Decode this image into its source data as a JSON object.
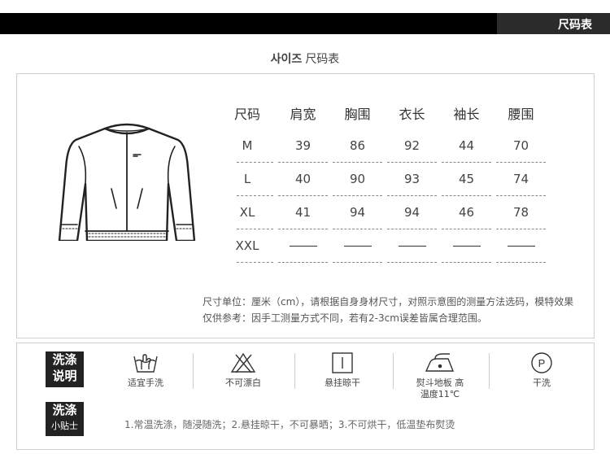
{
  "header": {
    "tab_label": "尺码表"
  },
  "subtitle": {
    "korean": "사이즈",
    "chinese": "尺码表"
  },
  "size_table": {
    "columns": [
      "尺码",
      "肩宽",
      "胸围",
      "衣长",
      "袖长",
      "腰围"
    ],
    "rows": [
      [
        "M",
        "39",
        "86",
        "92",
        "44",
        "70"
      ],
      [
        "L",
        "40",
        "90",
        "93",
        "45",
        "74"
      ],
      [
        "XL",
        "41",
        "94",
        "94",
        "46",
        "78"
      ],
      [
        "XXL",
        "",
        "",
        "",
        "",
        ""
      ]
    ]
  },
  "notes": {
    "line1": "尺寸单位：厘米（cm），请根据自身身材尺寸，对照示意图的测量方法选码，模特效果",
    "line2": "仅供参考：因手工测量方式不同，若有2-3cm误差皆属合理范围。"
  },
  "wash": {
    "label_line1": "洗涤",
    "label_line2": "说明",
    "items": [
      {
        "icon": "hand-wash-icon",
        "caption": "适宜手洗"
      },
      {
        "icon": "no-bleach-icon",
        "caption": "不可漂白"
      },
      {
        "icon": "hang-dry-icon",
        "caption": "悬挂晾干"
      },
      {
        "icon": "iron-icon",
        "caption": "熨斗地板  高",
        "caption2": "温度11℃"
      },
      {
        "icon": "dry-clean-icon",
        "caption": "干洗",
        "symbol": "P"
      }
    ]
  },
  "tips": {
    "label_line1": "洗涤",
    "label_line2": "小贴士",
    "text": "1.常温洗涤，随浸随洗；2.悬挂晾干，不可暴晒；3.不可烘干，低温垫布熨烫"
  }
}
